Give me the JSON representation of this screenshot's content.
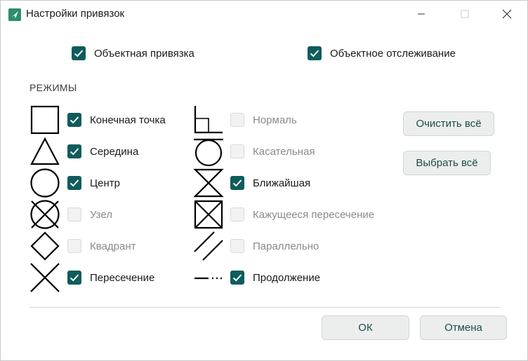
{
  "window": {
    "title": "Настройки привязок"
  },
  "top_options": [
    {
      "label": "Объектная привязка",
      "checked": true
    },
    {
      "label": "Объектное отслеживание",
      "checked": true
    }
  ],
  "modes_title": "РЕЖИМЫ",
  "modes_left": [
    {
      "label": "Конечная точка",
      "checked": true,
      "icon": "endpoint-square-icon"
    },
    {
      "label": "Середина",
      "checked": true,
      "icon": "midpoint-triangle-icon"
    },
    {
      "label": "Центр",
      "checked": true,
      "icon": "center-circle-icon"
    },
    {
      "label": "Узел",
      "checked": false,
      "icon": "node-circle-x-icon"
    },
    {
      "label": "Квадрант",
      "checked": false,
      "icon": "quadrant-diamond-icon"
    },
    {
      "label": "Пересечение",
      "checked": true,
      "icon": "intersection-x-icon"
    }
  ],
  "modes_right": [
    {
      "label": "Нормаль",
      "checked": false,
      "icon": "perpendicular-icon"
    },
    {
      "label": "Касательная",
      "checked": false,
      "icon": "tangent-icon"
    },
    {
      "label": "Ближайшая",
      "checked": true,
      "icon": "nearest-hourglass-icon"
    },
    {
      "label": "Кажущееся пересечение",
      "checked": false,
      "icon": "apparent-intersection-icon"
    },
    {
      "label": "Параллельно",
      "checked": false,
      "icon": "parallel-icon"
    },
    {
      "label": "Продолжение",
      "checked": true,
      "icon": "extension-icon"
    }
  ],
  "buttons": {
    "clear_all": "Очистить всё",
    "select_all": "Выбрать всё",
    "ok": "ОК",
    "cancel": "Отмена"
  },
  "colors": {
    "accent": "#0f5c5d",
    "disabled_text": "#8a8a8a"
  }
}
